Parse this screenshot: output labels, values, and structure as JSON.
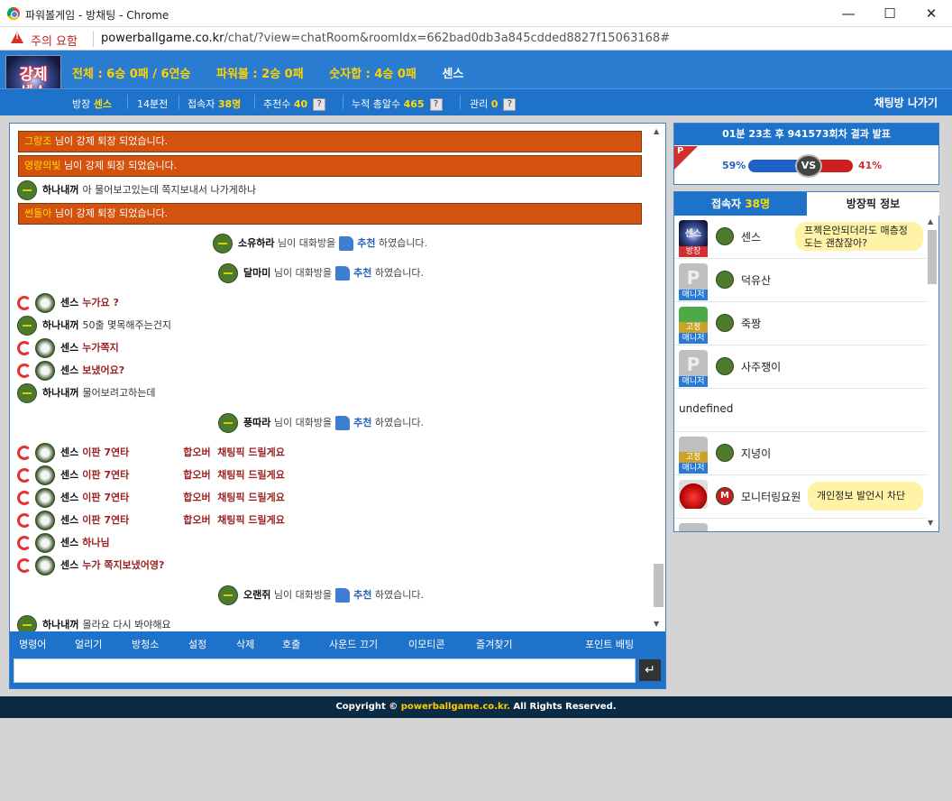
{
  "window": {
    "title": "파워볼게임 - 방채팅 - Chrome",
    "min": "—",
    "max": "☐",
    "close": "✕"
  },
  "urlbar": {
    "warning": "주의 요함",
    "host": "powerballgame.co.kr",
    "path": "/chat/?view=chatRoom&roomIdx=662bad0db3a845cdded8827f15063168#"
  },
  "header": {
    "logo_text": "강제\n센스",
    "stats": [
      "전체 : 6승 0패 / 6연승",
      "파워볼 : 2승 0패",
      "숫자합 : 4승 0패"
    ],
    "owner_name": "센스",
    "info": {
      "owner_label": "방장",
      "owner": "센스",
      "time": "14분전",
      "users_label": "접속자",
      "users": "38명",
      "rec_label": "추천수",
      "rec": "40",
      "acc_label": "누적 총알수",
      "acc": "465",
      "admin_label": "관리",
      "admin": "0",
      "q": "?"
    },
    "leave": "채팅방 나가기"
  },
  "chat": {
    "kick_suffix": "님이 강제 퇴장 되었습니다.",
    "kicks": [
      "그랑조",
      "영랑의빛",
      "썬돌아"
    ],
    "rec_mid": "님이 대화방을",
    "rec_word": "추천",
    "rec_end": "하였습니다.",
    "recommenders": [
      "소유하라",
      "달마미",
      "풍따라",
      "오랜쥐"
    ],
    "msgs": [
      {
        "user": "하나내꺼",
        "text": "아 물어보고있는데 쪽지보내서 나가게하나"
      },
      {
        "user": "센스",
        "text": "누가요 ?"
      },
      {
        "user": "하나내꺼",
        "text": "50출 몇목해주는건지"
      },
      {
        "user": "센스",
        "text": "누가쪽지"
      },
      {
        "user": "센스",
        "text": "보냈어요?"
      },
      {
        "user": "하나내꺼",
        "text": "물어보려고하는데"
      },
      {
        "user": "센스",
        "text": "이판 7연타",
        "text2": "합오버  채팅픽 드릴게요"
      },
      {
        "user": "센스",
        "text": "이판 7연타",
        "text2": "합오버  채팅픽 드릴게요"
      },
      {
        "user": "센스",
        "text": "이판 7연타",
        "text2": "합오버  채팅픽 드릴게요"
      },
      {
        "user": "센스",
        "text": "이판 7연타",
        "text2": "합오버  채팅픽 드릴게요"
      },
      {
        "user": "센스",
        "text": "하나님"
      },
      {
        "user": "센스",
        "text": "누가 쪽지보냈어영?"
      },
      {
        "user": "하나내꺼",
        "text": "몰라요 다시 봐야해요"
      }
    ],
    "menu": [
      "명령어",
      "얼리기",
      "방청소",
      "설정",
      "삭제",
      "호출",
      "사운드 끄기",
      "이모티콘",
      "즐겨찾기",
      "포인트 배팅"
    ],
    "send_icon": "↵"
  },
  "result": {
    "header_pre": "01분 23초 후",
    "round": "941573회차",
    "header_post": "결과 발표",
    "p": "P",
    "left_pct": "59%",
    "right_pct": "41%",
    "left_ratio": 0.59,
    "right_ratio": 0.41,
    "vs": "VS"
  },
  "users": {
    "tab1_label": "접속자",
    "tab1_count": "38명",
    "tab2_label": "방장픽 정보",
    "rows": [
      {
        "name": "센스",
        "tag": "방장",
        "bubble": "프젝은안되더라도 매층정도는 괜찮잖아?"
      },
      {
        "name": "덕유산",
        "tag": "매니저",
        "avatar": "P"
      },
      {
        "name": "죽짱",
        "tag": "매니저",
        "tag2": "고정"
      },
      {
        "name": "사주쟁이",
        "tag": "매니저",
        "avatar": "P"
      },
      {
        "name": "undefined"
      },
      {
        "name": "지녕이",
        "tag": "매니저",
        "tag2": "고정"
      },
      {
        "name": "모니터링요원",
        "bubble": "개인정보 발언시 차단",
        "level": "M"
      }
    ]
  },
  "footer": {
    "pre": "Copyright ©",
    "site": "powerballgame.co.kr.",
    "post": "All Rights Reserved."
  }
}
